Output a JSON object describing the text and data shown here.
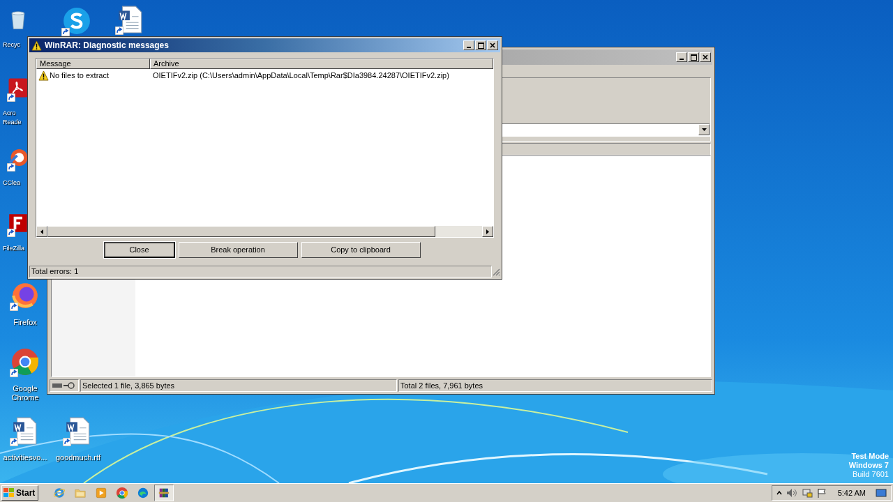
{
  "desktop": {
    "icons": [
      {
        "kind": "recycle",
        "label": "Recyc"
      },
      {
        "kind": "skype"
      },
      {
        "kind": "word"
      },
      {
        "kind": "acrobat",
        "label": "Acro Reade"
      },
      {
        "kind": "ccleaner",
        "label": "CClea"
      },
      {
        "kind": "filezilla",
        "label": "FileZilla"
      },
      {
        "kind": "firefox",
        "label": "Firefox"
      },
      {
        "kind": "chrome",
        "label": "Google Chrome"
      },
      {
        "kind": "word",
        "label": "activitiesvo..."
      },
      {
        "kind": "word",
        "label": "goodmuch.rtf"
      }
    ],
    "notice": [
      "Test Mode",
      "Windows 7",
      "Build 7601"
    ]
  },
  "main_window": {
    "status_bar": [
      "Selected 1 file, 3,865 bytes",
      "Total 2 files, 7,961 bytes"
    ]
  },
  "dialog": {
    "title": "WinRAR: Diagnostic messages",
    "columns": [
      "Message",
      "Archive"
    ],
    "rows": [
      {
        "message": "No files to extract",
        "archive": "OIETIFv2.zip (C:\\Users\\admin\\AppData\\Local\\Temp\\Rar$DIa3984.24287\\OIETIFv2.zip)"
      }
    ],
    "buttons": [
      {
        "label": "Close",
        "default": true
      },
      {
        "label": "Break operation",
        "default": false
      },
      {
        "label": "Copy to clipboard",
        "default": false
      }
    ],
    "status": "Total errors: 1"
  },
  "taskbar": {
    "start": "Start",
    "apps": [
      {
        "kind": "ie",
        "active": false
      },
      {
        "kind": "folder",
        "active": false
      },
      {
        "kind": "media",
        "active": false
      },
      {
        "kind": "chrome",
        "active": false
      },
      {
        "kind": "edge",
        "active": false
      },
      {
        "kind": "winrar",
        "active": true
      }
    ],
    "clock": "5:42 AM"
  }
}
